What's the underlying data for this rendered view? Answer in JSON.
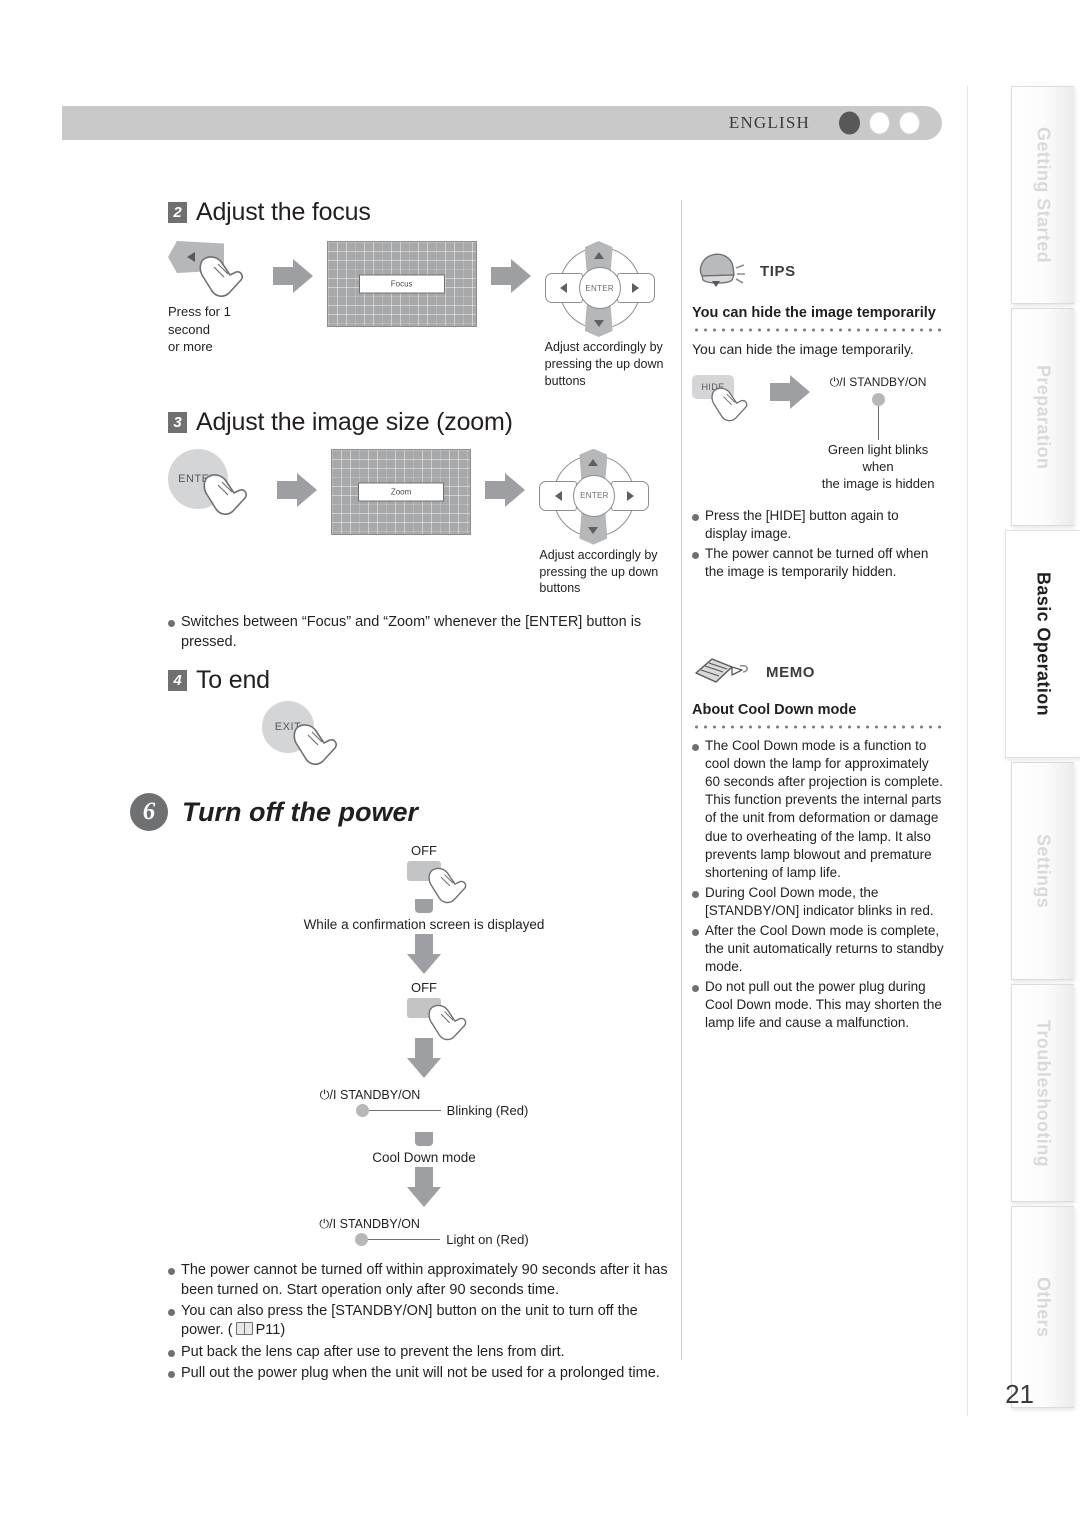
{
  "header": {
    "language": "ENGLISH",
    "dots": [
      "filled",
      "empty",
      "empty"
    ]
  },
  "left_column": {
    "step2": {
      "number": "2",
      "title": "Adjust the focus",
      "flow": {
        "key_label": "",
        "key_caption": "Press for 1 second\nor more",
        "key_caption_line1": "Press for 1 second",
        "key_caption_line2": "or more",
        "screen_osd": "Focus",
        "dpad_enter": "ENTER",
        "dpad_caption_line1": "Adjust accordingly by",
        "dpad_caption_line2": "pressing the up down buttons"
      }
    },
    "step3": {
      "number": "3",
      "title": "Adjust the image size (zoom)",
      "flow": {
        "key_label": "ENTER",
        "screen_osd": "Zoom",
        "dpad_enter": "ENTER",
        "dpad_caption_line1": "Adjust accordingly by",
        "dpad_caption_line2": "pressing the up down buttons"
      }
    },
    "note_after_step3": "Switches between “Focus” and “Zoom” whenever the [ENTER] button is pressed.",
    "step4": {
      "number": "4",
      "title": "To end",
      "key_label": "EXIT"
    },
    "step6": {
      "number": "6",
      "title": "Turn off the power",
      "flow": {
        "off_label_1": "OFF",
        "confirm_text": "While a confirmation screen is displayed",
        "off_label_2": "OFF",
        "indicator_1_title": "⏻/I  STANDBY/ON",
        "indicator_1_note": "Blinking (Red)",
        "cooldown_text": "Cool Down mode",
        "indicator_2_title": "⏻/I  STANDBY/ON",
        "indicator_2_note": "Light on (Red)"
      },
      "bullets": [
        "The power cannot be turned off within approximately 90 seconds after it has been turned on. Start operation only after 90 seconds time.",
        "You can also press the [STANDBY/ON] button on the unit to turn off the power. (▤ P11)",
        "Put back the lens cap after use to prevent the lens from dirt.",
        "Pull out the power plug when the unit will not be used for a prolonged time."
      ],
      "bullet2_prefix": "You can also press the [STANDBY/ON] button on the unit to turn off the power. (",
      "bullet2_page_ref": "P11",
      "bullet2_suffix": ")"
    }
  },
  "right_column": {
    "tips": {
      "label": "TIPS",
      "icon": "bell-icon",
      "title": "You can hide the image temporarily",
      "body": "You can hide the image temporarily.",
      "flow": {
        "hide_button": "HIDE",
        "indicator_title": "⏻/I  STANDBY/ON",
        "caption_line1": "Green light blinks when",
        "caption_line2": "the image is hidden"
      },
      "bullets": [
        "Press the [HIDE] button again to display image.",
        "The power cannot be turned off when the image is temporarily hidden."
      ]
    },
    "memo": {
      "label": "MEMO",
      "icon": "pencil-icon",
      "title": "About Cool Down mode",
      "bullets": [
        "The Cool Down mode is a function to cool down the lamp for approximately 60 seconds after projection is complete. This function prevents the internal parts of the unit from deformation or damage due to overheating of the lamp. It also prevents lamp blowout and premature shortening of lamp life.",
        "During Cool Down mode, the [STANDBY/ON] indicator blinks in red.",
        "After the Cool Down mode is complete, the unit automatically returns to standby mode.",
        "Do not pull out the power plug during Cool Down mode. This may shorten the lamp life and cause a malfunction."
      ]
    }
  },
  "tabs": [
    {
      "label": "Getting Started",
      "active": false
    },
    {
      "label": "Preparation",
      "active": false
    },
    {
      "label": "Basic Operation",
      "active": true
    },
    {
      "label": "Settings",
      "active": false
    },
    {
      "label": "Troubleshooting",
      "active": false
    },
    {
      "label": "Others",
      "active": false
    }
  ],
  "page_number": "21"
}
